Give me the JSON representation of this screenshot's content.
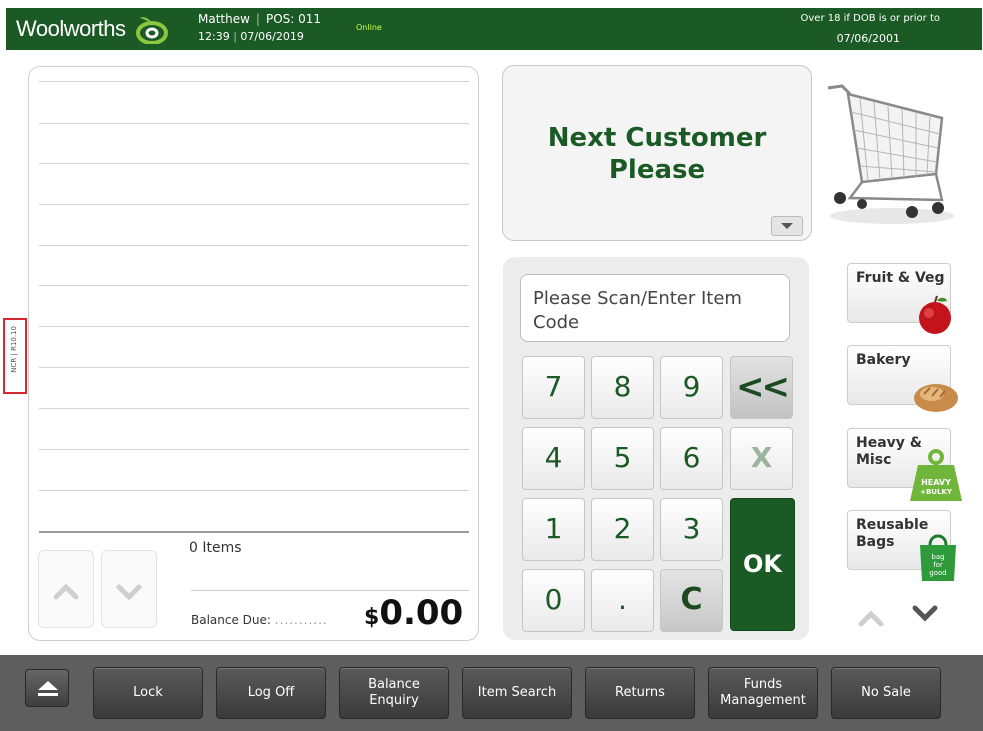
{
  "header": {
    "brand": "Woolworths",
    "operator": "Matthew",
    "pos": "POS: 011",
    "time": "12:39",
    "date": "07/06/2019",
    "status": "Online",
    "age_notice_line1": "Over 18 if DOB is or prior to",
    "age_notice_date": "07/06/2001",
    "colors": {
      "brand_green": "#1c5a25",
      "online": "#c8ff3a"
    }
  },
  "transaction": {
    "items_count": "0 Items",
    "balance_label": "Balance Due:",
    "balance_dots": "...........",
    "currency": "$",
    "balance_amount": "0.00"
  },
  "message": {
    "line1": "Next Customer",
    "line2": "Please"
  },
  "scan": {
    "placeholder_line1": "Please Scan/Enter Item",
    "placeholder_line2": "Code"
  },
  "keypad": {
    "keys": [
      "7",
      "8",
      "9",
      "4",
      "5",
      "6",
      "1",
      "2",
      "3",
      "0",
      "."
    ],
    "backspace": "<<",
    "cancel": "X",
    "clear": "C",
    "ok": "OK"
  },
  "categories": [
    {
      "label": "Fruit & Veg",
      "icon": "apple-icon"
    },
    {
      "label": "Bakery",
      "icon": "bread-icon"
    },
    {
      "label": "Heavy & Misc",
      "icon": "heavy-weight-icon",
      "badge": "HEAVY +BULKY"
    },
    {
      "label": "Reusable Bags",
      "icon": "green-bag-icon",
      "badge": "bag for good"
    }
  ],
  "bottom_bar": {
    "buttons": [
      "Lock",
      "Log Off",
      "Balance Enquiry",
      "Item Search",
      "Returns",
      "Funds Management",
      "No Sale"
    ]
  },
  "side_tag": "NCR | R10.10"
}
